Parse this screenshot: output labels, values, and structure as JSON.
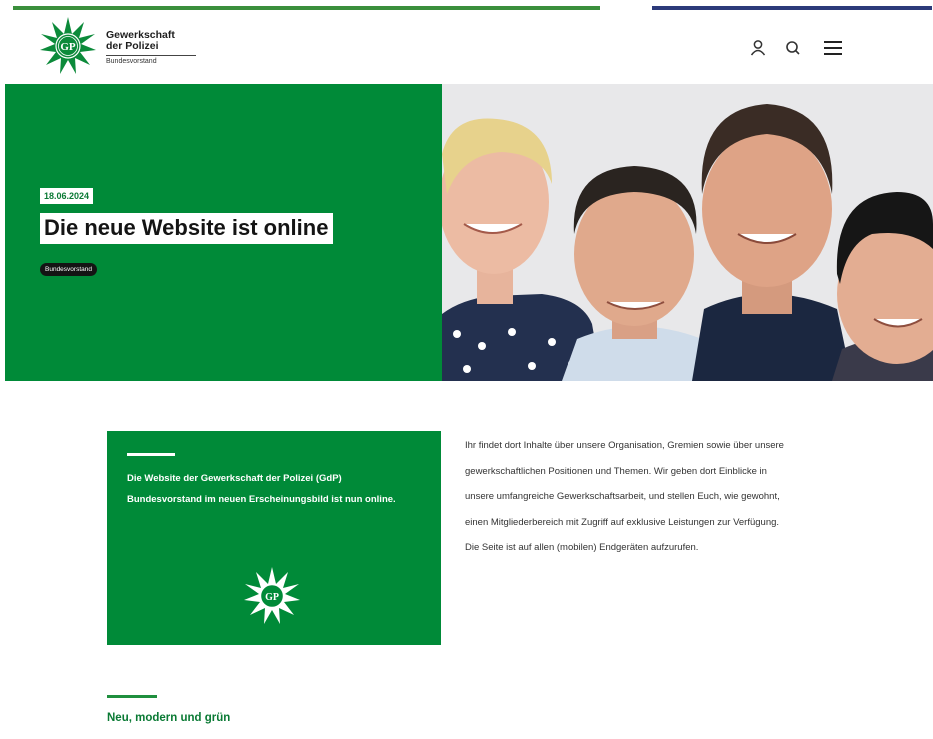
{
  "header": {
    "brand_line1": "Gewerkschaft",
    "brand_line2": "der Polizei",
    "brand_sub": "Bundesvorstand",
    "icons": [
      "user-icon",
      "search-icon",
      "menu-icon"
    ]
  },
  "hero": {
    "date": "18.06.2024",
    "title": "Die neue Website ist online",
    "tag": "Bundesvorstand"
  },
  "intro": {
    "box_text": "Die Website der Gewerkschaft der Polizei (GdP) Bundesvorstand im neuen Erscheinungsbild ist nun online.",
    "body_text": "Ihr findet dort Inhalte über unsere Organisation, Gremien sowie über unsere gewerkschaftlichen Positionen und Themen. Wir geben dort Einblicke in unsere umfangreiche Gewerkschaftsarbeit, und stellen Euch, wie gewohnt, einen Mitgliederbereich mit Zugriff auf exklusive Leistungen zur Verfügung. Die Seite ist auf allen (mobilen) Endgeräten aufzurufen."
  },
  "section": {
    "title": "Neu, modern und grün"
  },
  "colors": {
    "brand_green": "#008a38",
    "accent_blue": "#2c3a7a",
    "text_green": "#0a7a34"
  }
}
